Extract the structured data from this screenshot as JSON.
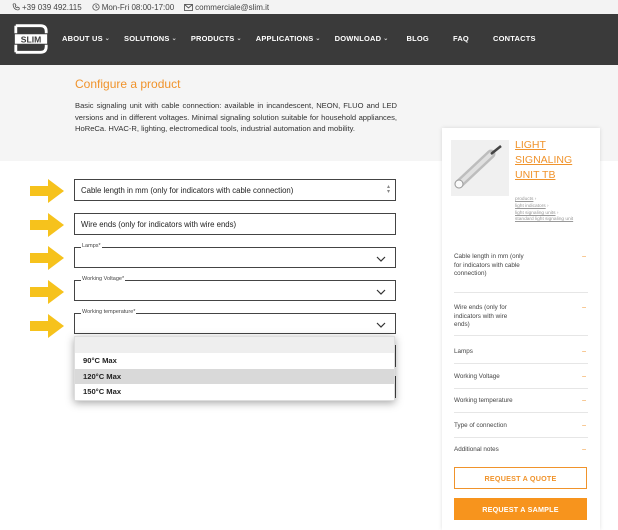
{
  "topbar": {
    "phone": "+39 039 492.115",
    "hours": "Mon-Fri 08:00-17:00",
    "email": "commerciale@slim.it"
  },
  "brand": {
    "logo_text": "SLIM",
    "accent": "#f0932b",
    "nav_bg": "#3a3a3a"
  },
  "nav": {
    "items": [
      {
        "label": "ABOUT US",
        "dropdown": true
      },
      {
        "label": "SOLUTIONS",
        "dropdown": true
      },
      {
        "label": "PRODUCTS",
        "dropdown": true
      },
      {
        "label": "APPLICATIONS",
        "dropdown": true
      },
      {
        "label": "DOWNLOAD",
        "dropdown": true
      },
      {
        "label": "BLOG",
        "dropdown": false
      },
      {
        "label": "FAQ",
        "dropdown": false
      },
      {
        "label": "CONTACTS",
        "dropdown": false
      }
    ]
  },
  "page": {
    "title": "Configure a product",
    "description": "Basic signaling unit with cable connection: available in incandescent, NEON, FLUO and LED versions and in different voltages. Minimal signaling solution suitable for household appliances, HoReCa. HVAC-R, lighting, electromedical tools, industrial automation and mobility."
  },
  "form": {
    "cable_length_placeholder": "Cable length in mm (only for indicators with cable connection)",
    "wire_ends_placeholder": "Wire ends (only for indicators with wire ends)",
    "lamps_label": "Lamps*",
    "voltage_label": "Working Voltage*",
    "temperature_label": "Working temperature*",
    "temperature_options": [
      "90°C Max",
      "120°C Max",
      "150°C Max"
    ],
    "temperature_highlighted": "120°C Max"
  },
  "sidebar": {
    "product_title": "LIGHT SIGNALING UNIT TB",
    "breadcrumb": [
      "products",
      "light indicators",
      "light signaling units",
      "standard light signaling unit"
    ],
    "rows": [
      "Cable length in mm (only for indicators with cable connection)",
      "Wire ends (only for indicators with wire ends)",
      "Lamps",
      "Working Voltage",
      "Working temperature",
      "Type of connection",
      "Additional notes"
    ],
    "row_dash": "–",
    "quote_button": "REQUEST A QUOTE",
    "sample_button": "REQUEST A SAMPLE"
  }
}
